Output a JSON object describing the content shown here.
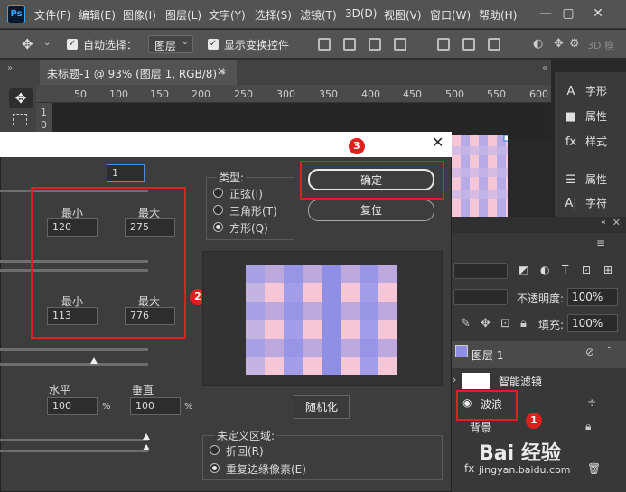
{
  "app": {
    "logo": "Ps",
    "menu": [
      "文件(F)",
      "编辑(E)",
      "图像(I)",
      "图层(L)",
      "文字(Y)",
      "选择(S)",
      "滤镜(T)",
      "3D(D)",
      "视图(V)",
      "窗口(W)",
      "帮助(H)"
    ]
  },
  "options": {
    "auto_select_label": "自动选择：",
    "auto_select_value": "图层",
    "show_transform_label": "显示变换控件",
    "mode_3d": "3D 模"
  },
  "document": {
    "tab_title": "未标题-1 @ 93% (图层 1, RGB/8) *",
    "ruler_ticks": [
      "50",
      "100",
      "150",
      "200",
      "250",
      "300",
      "350",
      "400",
      "450",
      "500",
      "550",
      "600"
    ],
    "ruler_left": [
      "1",
      "0"
    ]
  },
  "right_panel": {
    "items": [
      {
        "icon": "character-icon",
        "glyph": "A",
        "label": "字形"
      },
      {
        "icon": "properties-icon",
        "glyph": "■",
        "label": "属性"
      },
      {
        "icon": "styles-icon",
        "glyph": "fx",
        "label": "样式"
      },
      {
        "icon": "adjust-icon",
        "glyph": "☰",
        "label": "属性"
      },
      {
        "icon": "char-icon",
        "glyph": "A|",
        "label": "字符"
      }
    ]
  },
  "layers_panel": {
    "opacity_label": "不透明度:",
    "opacity_value": "100%",
    "fill_label": "填充:",
    "fill_value": "100%",
    "layers": [
      {
        "name": "图层 1"
      },
      {
        "name": "智能滤镜"
      },
      {
        "name": "波浪"
      },
      {
        "name": "背景"
      }
    ],
    "watermark": "Bai 经验",
    "watermark_url": "jingyan.baidu.com"
  },
  "dialog": {
    "field_top": "1",
    "group1": {
      "min_label": "最小",
      "max_label": "最大",
      "min_value": "120",
      "max_value": "275"
    },
    "group2": {
      "min_label": "最小",
      "max_label": "最大",
      "min_value": "113",
      "max_value": "776"
    },
    "horizontal_label": "水平",
    "vertical_label": "垂直",
    "horizontal_value": "100",
    "vertical_value": "100",
    "percent": "%",
    "type_label": "类型:",
    "types": [
      "正弦(I)",
      "三角形(T)",
      "方形(Q)"
    ],
    "ok_label": "确定",
    "reset_label": "复位",
    "randomize_label": "随机化",
    "undefined_label": "未定义区域:",
    "undefined_options": [
      "折回(R)",
      "重复边缘像素(E)"
    ],
    "badges": [
      "1",
      "2",
      "3"
    ],
    "colors": {
      "purple": "#8f8fe6",
      "pink": "#f4c6d6",
      "mid": "#c3b4e2",
      "red": "#e02020"
    }
  }
}
